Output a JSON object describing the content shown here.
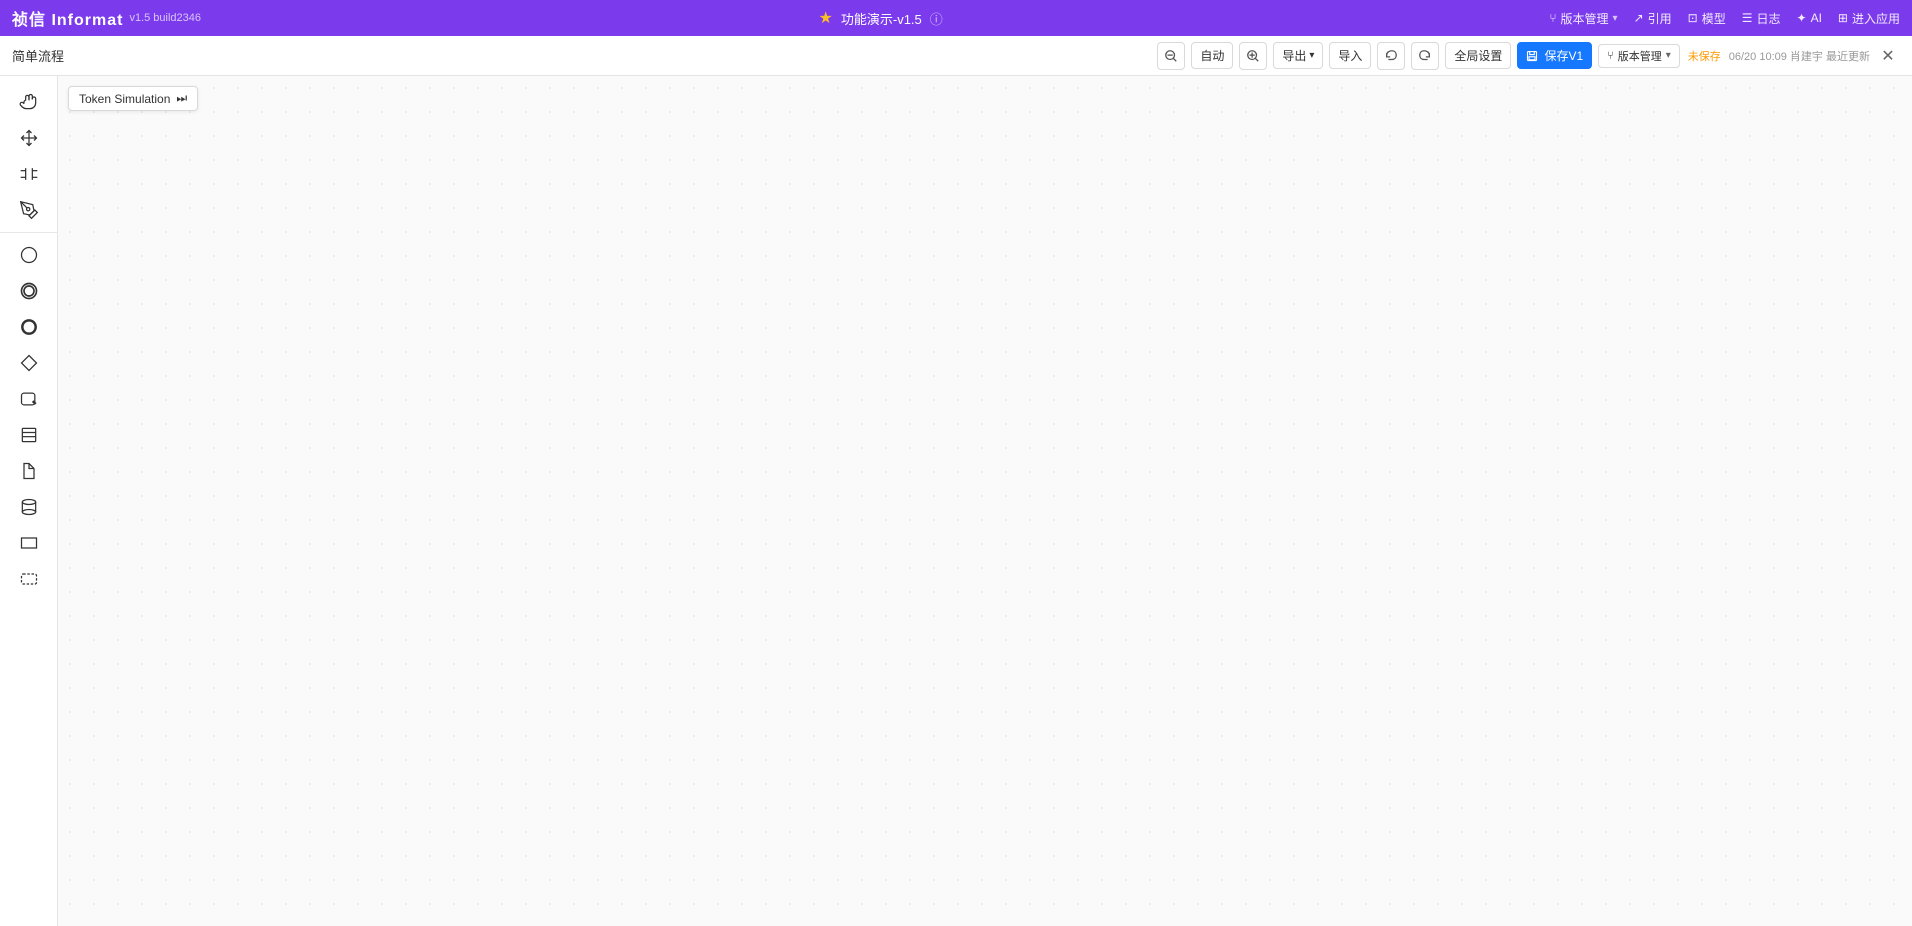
{
  "topbar": {
    "logo": "祯信 Informat",
    "version": "v1.5 build2346",
    "project_name": "功能演示-v1.5",
    "nav_items": [
      {
        "id": "version-mgmt",
        "icon": "🔀",
        "label": "版本管理",
        "has_dropdown": true
      },
      {
        "id": "cite",
        "icon": "↗",
        "label": "引用"
      },
      {
        "id": "model",
        "icon": "⊡",
        "label": "模型"
      },
      {
        "id": "log",
        "icon": "☰",
        "label": "日志"
      },
      {
        "id": "ai",
        "icon": "✦",
        "label": "AI"
      },
      {
        "id": "enter-app",
        "icon": "⊞",
        "label": "进入应用"
      }
    ]
  },
  "toolbar": {
    "page_title": "简单流程",
    "buttons": {
      "zoom_out": "−",
      "auto": "自动",
      "zoom_in": "+",
      "export": "导出",
      "import": "导入",
      "undo": "↩",
      "redo": "↪",
      "global_settings": "全局设置",
      "save_v1": "保存V1",
      "version_mgmt": "版本管理"
    },
    "version_info": {
      "unsaved": "未保存",
      "save_time": "06/20 10:09 肖建宇 最近更新"
    }
  },
  "token_simulation": {
    "label": "Token Simulation",
    "icon": "⏭"
  },
  "left_tools": {
    "nav_section": [
      {
        "id": "hand",
        "symbol": "✋",
        "label": "手形工具"
      },
      {
        "id": "move",
        "symbol": "✛",
        "label": "移动工具"
      },
      {
        "id": "split",
        "symbol": "⊣⊢",
        "label": "拆分工具"
      },
      {
        "id": "pen",
        "symbol": "✒",
        "label": "画笔工具"
      }
    ],
    "shape_section": [
      {
        "id": "circle-outline",
        "symbol": "○",
        "label": "空心圆"
      },
      {
        "id": "circle-double",
        "symbol": "◎",
        "label": "双圆"
      },
      {
        "id": "circle-thick",
        "symbol": "●",
        "label": "粗圆"
      },
      {
        "id": "diamond",
        "symbol": "◇",
        "label": "菱形"
      },
      {
        "id": "rounded-rect",
        "symbol": "▭",
        "label": "圆角矩形"
      },
      {
        "id": "database-box",
        "symbol": "⊟",
        "label": "数据框"
      },
      {
        "id": "doc",
        "symbol": "📄",
        "label": "文档"
      },
      {
        "id": "cylinder",
        "symbol": "⊜",
        "label": "柱形"
      },
      {
        "id": "rect",
        "symbol": "▬",
        "label": "矩形"
      },
      {
        "id": "dashed-rect",
        "symbol": "⬚",
        "label": "虚线矩形"
      }
    ]
  }
}
